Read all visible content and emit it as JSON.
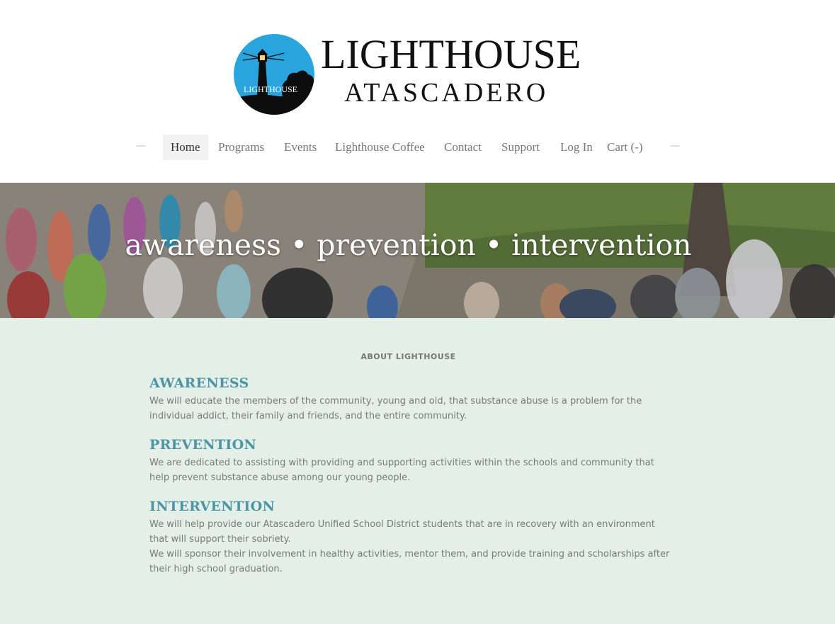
{
  "logo": {
    "title": "LIGHTHOUSE",
    "subtitle": "ATASCADERO",
    "badge_text": "LIGHTHOUSE",
    "circle_color": "#2aa4dc"
  },
  "nav": {
    "items": [
      {
        "label": "Home",
        "active": true
      },
      {
        "label": "Programs"
      },
      {
        "label": "Events"
      },
      {
        "label": "Lighthouse Coffee"
      },
      {
        "label": "Contact"
      },
      {
        "label": "Support"
      },
      {
        "label": "Log In"
      },
      {
        "label": "Cart (-)"
      }
    ],
    "dash_left": "—",
    "dash_right": "—"
  },
  "hero": {
    "tagline": "awareness • prevention • intervention"
  },
  "about": {
    "label": "ABOUT LIGHTHOUSE",
    "sections": [
      {
        "heading": "AWARENESS",
        "paragraphs": [
          "We will educate the members of the community, young and old, that substance abuse is a problem for the individual addict, their family and friends, and the entire community."
        ]
      },
      {
        "heading": "PREVENTION",
        "paragraphs": [
          "We are dedicated to assisting with providing and supporting activities within the schools and community that help prevent substance abuse among our young people."
        ]
      },
      {
        "heading": "INTERVENTION",
        "paragraphs": [
          "We will help provide our Atascadero Unified School District students that are in recovery with an environment that will support their sobriety.",
          "We will sponsor their involvement in healthy activities, mentor them, and provide training and scholarships after their high school graduation."
        ]
      }
    ]
  },
  "colors": {
    "accent": "#4b95a6",
    "about_bg": "#e3efe7"
  }
}
